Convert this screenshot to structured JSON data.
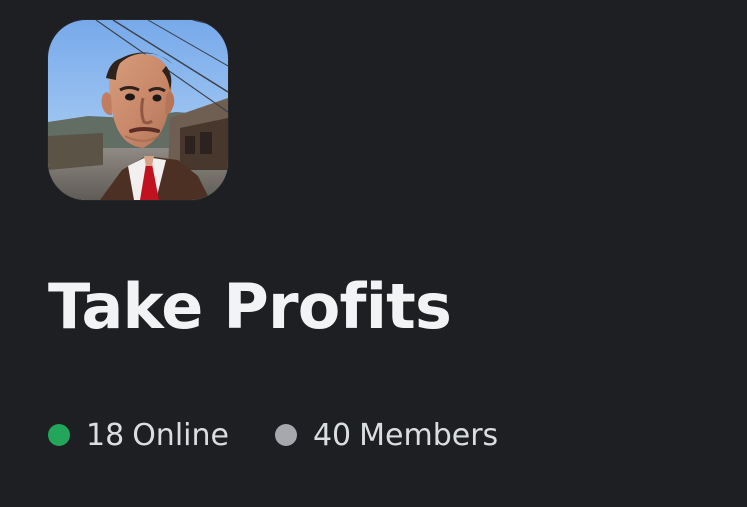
{
  "server": {
    "name": "Take Profits"
  },
  "stats": {
    "online": {
      "count": "18",
      "label": "Online",
      "color": "#23a55a"
    },
    "members": {
      "count": "40",
      "label": "Members",
      "color": "#a6a8ad"
    }
  },
  "theme": {
    "background": "#1e1f22",
    "text": "#f2f3f5"
  },
  "icons": {
    "server_icon": "server-avatar-icon",
    "online_dot": "online-status-dot-icon",
    "member_dot": "member-status-dot-icon"
  }
}
